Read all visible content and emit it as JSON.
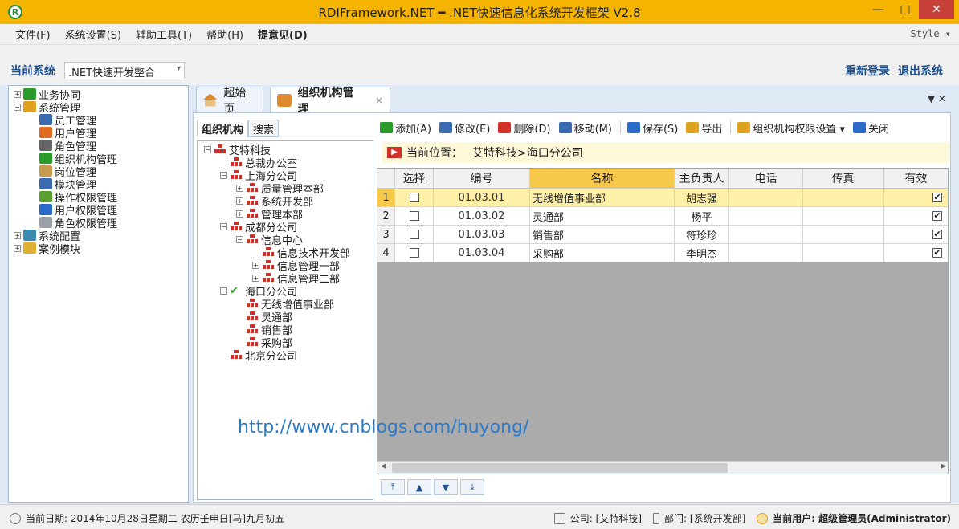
{
  "window": {
    "title": "RDIFramework.NET ━ .NET快速信息化系统开发框架 V2.8",
    "minimize": "—",
    "maximize": "□",
    "close": "✕"
  },
  "menu": {
    "items": [
      "文件(F)",
      "系统设置(S)",
      "辅助工具(T)",
      "帮助(H)",
      "提意见(D)"
    ],
    "style": "Style ▾"
  },
  "sysbar": {
    "label": "当前系统",
    "selected": ".NET快速开发整合",
    "relogin": "重新登录",
    "exit": "退出系统"
  },
  "nav": {
    "items": [
      {
        "label": "业务协同",
        "level": 0,
        "expander": "+",
        "color": "#2a9a2a"
      },
      {
        "label": "系统管理",
        "level": 0,
        "expander": "−",
        "color": "#e0a020"
      },
      {
        "label": "员工管理",
        "level": 1,
        "expander": "",
        "color": "#3a6ab0"
      },
      {
        "label": "用户管理",
        "level": 1,
        "expander": "",
        "color": "#e06a20"
      },
      {
        "label": "角色管理",
        "level": 1,
        "expander": "",
        "color": "#666666"
      },
      {
        "label": "组织机构管理",
        "level": 1,
        "expander": "",
        "color": "#2a9a2a"
      },
      {
        "label": "岗位管理",
        "level": 1,
        "expander": "",
        "color": "#c89a50"
      },
      {
        "label": "模块管理",
        "level": 1,
        "expander": "",
        "color": "#3a6ab0"
      },
      {
        "label": "操作权限管理",
        "level": 1,
        "expander": "",
        "color": "#5aa030"
      },
      {
        "label": "用户权限管理",
        "level": 1,
        "expander": "",
        "color": "#2a6ac8"
      },
      {
        "label": "角色权限管理",
        "level": 1,
        "expander": "",
        "color": "#9aa0a8"
      },
      {
        "label": "系统配置",
        "level": 0,
        "expander": "+",
        "color": "#3a8ab0"
      },
      {
        "label": "案例模块",
        "level": 0,
        "expander": "+",
        "color": "#e0b030"
      }
    ]
  },
  "tabs": [
    {
      "label": "超始页",
      "active": false
    },
    {
      "label": "组织机构管理",
      "active": true,
      "close": "×"
    }
  ],
  "tab_menu": "▼ ✕",
  "org_panel": {
    "tabs": [
      "组织机构",
      "搜索"
    ],
    "tree": [
      {
        "label": "艾特科技",
        "level": 0,
        "expander": "−",
        "icon": "org"
      },
      {
        "label": "总裁办公室",
        "level": 1,
        "expander": "",
        "icon": "org"
      },
      {
        "label": "上海分公司",
        "level": 1,
        "expander": "−",
        "icon": "org"
      },
      {
        "label": "质量管理本部",
        "level": 2,
        "expander": "+",
        "icon": "org"
      },
      {
        "label": "系统开发部",
        "level": 2,
        "expander": "+",
        "icon": "org"
      },
      {
        "label": "管理本部",
        "level": 2,
        "expander": "+",
        "icon": "org"
      },
      {
        "label": "成都分公司",
        "level": 1,
        "expander": "−",
        "icon": "org"
      },
      {
        "label": "信息中心",
        "level": 2,
        "expander": "−",
        "icon": "org"
      },
      {
        "label": "信息技术开发部",
        "level": 3,
        "expander": "",
        "icon": "org"
      },
      {
        "label": "信息管理一部",
        "level": 3,
        "expander": "+",
        "icon": "org"
      },
      {
        "label": "信息管理二部",
        "level": 3,
        "expander": "+",
        "icon": "org"
      },
      {
        "label": "海口分公司",
        "level": 1,
        "expander": "−",
        "icon": "check"
      },
      {
        "label": "无线增值事业部",
        "level": 2,
        "expander": "",
        "icon": "org"
      },
      {
        "label": "灵通部",
        "level": 2,
        "expander": "",
        "icon": "org"
      },
      {
        "label": "销售部",
        "level": 2,
        "expander": "",
        "icon": "org"
      },
      {
        "label": "采购部",
        "level": 2,
        "expander": "",
        "icon": "org"
      },
      {
        "label": "北京分公司",
        "level": 1,
        "expander": "",
        "icon": "org"
      }
    ]
  },
  "toolbar": {
    "buttons": [
      {
        "label": "添加(A)",
        "icon": "add-icon",
        "color": "#2a9a2a"
      },
      {
        "label": "修改(E)",
        "icon": "edit-icon",
        "color": "#3a6ab0"
      },
      {
        "label": "删除(D)",
        "icon": "delete-icon",
        "color": "#d4302a"
      },
      {
        "label": "移动(M)",
        "icon": "move-icon",
        "color": "#3a6ab0"
      },
      {
        "label": "保存(S)",
        "icon": "save-icon",
        "color": "#2a6ac8"
      },
      {
        "label": "导出",
        "icon": "export-icon",
        "color": "#e0a020"
      },
      {
        "label": "组织机构权限设置 ▾",
        "icon": "key-icon",
        "color": "#e0a020"
      },
      {
        "label": "关闭",
        "icon": "close-doc-icon",
        "color": "#2a6ac8"
      }
    ]
  },
  "location": {
    "label": "当前位置：",
    "path": "艾特科技>海口分公司"
  },
  "grid": {
    "columns": [
      "选择",
      "编号",
      "名称",
      "主负责人",
      "电话",
      "传真",
      "有效"
    ],
    "rows": [
      {
        "n": "1",
        "selected": false,
        "code": "01.03.01",
        "name": "无线增值事业部",
        "manager": "胡志强",
        "phone": "",
        "fax": "",
        "valid": true
      },
      {
        "n": "2",
        "selected": false,
        "code": "01.03.02",
        "name": "灵通部",
        "manager": "杨平",
        "phone": "",
        "fax": "",
        "valid": true
      },
      {
        "n": "3",
        "selected": false,
        "code": "01.03.03",
        "name": "销售部",
        "manager": "符珍珍",
        "phone": "",
        "fax": "",
        "valid": true
      },
      {
        "n": "4",
        "selected": false,
        "code": "01.03.04",
        "name": "采购部",
        "manager": "李明杰",
        "phone": "",
        "fax": "",
        "valid": true
      }
    ]
  },
  "nav_buttons": [
    "⤒",
    "▲",
    "▼",
    "⤓"
  ],
  "watermark": "http://www.cnblogs.com/huyong/",
  "status": {
    "date": "当前日期: 2014年10月28日星期二 农历壬申日[马]九月初五",
    "company": "公司: [艾特科技]",
    "dept": "部门: [系统开发部]",
    "user_label": "当前用户:",
    "user_value": "超级管理员(Administrator)"
  }
}
